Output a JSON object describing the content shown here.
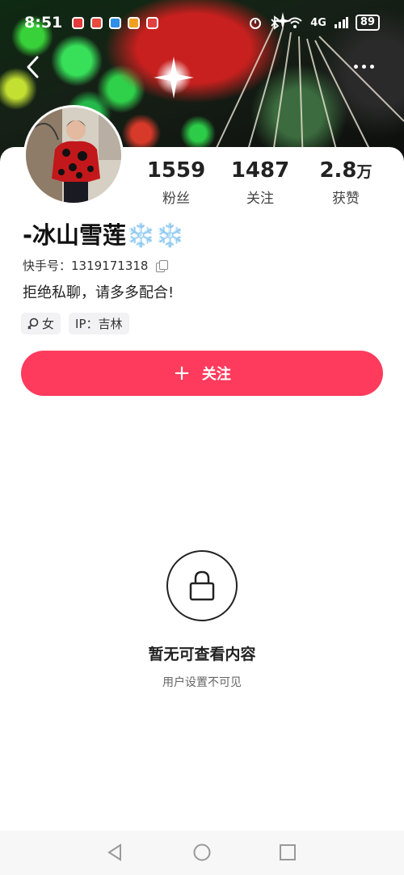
{
  "status_bar": {
    "time": "8:51",
    "network": "4G",
    "battery": "89",
    "notification_colors": [
      "#e23b3b",
      "#e84a3c",
      "#2f8ee8",
      "#f0a020",
      "#e24040"
    ]
  },
  "profile": {
    "name": "-冰山雪莲❄️❄️",
    "kuaishou_id_label": "快手号：",
    "kuaishou_id": "1319171318",
    "bio": "拒绝私聊，请多多配合!",
    "tags": {
      "gender_icon": "female-icon",
      "gender": "女",
      "ip": "IP：吉林"
    },
    "stats": [
      {
        "value": "1559",
        "unit": "",
        "label": "粉丝"
      },
      {
        "value": "1487",
        "unit": "",
        "label": "关注"
      },
      {
        "value": "2.8",
        "unit": "万",
        "label": "获赞"
      }
    ]
  },
  "actions": {
    "follow_label": "关注"
  },
  "empty_state": {
    "title": "暂无可查看内容",
    "subtitle": "用户设置不可见"
  },
  "colors": {
    "accent": "#fe3b5d",
    "tag_bg": "#f2f2f4"
  }
}
